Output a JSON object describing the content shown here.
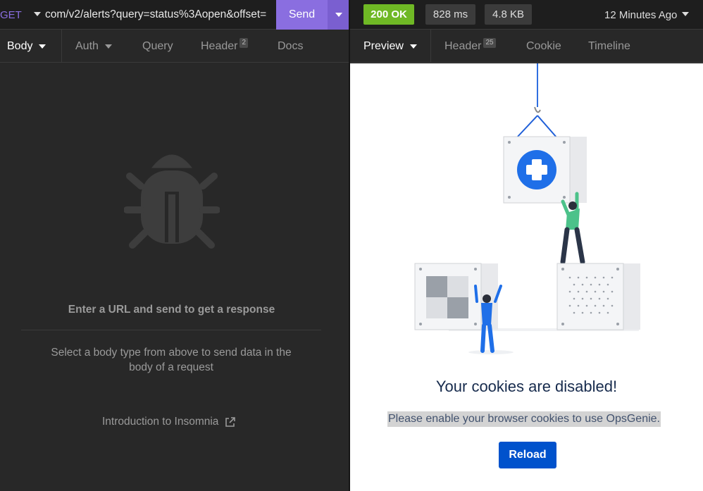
{
  "request": {
    "method": "GET",
    "url": "com/v2/alerts?query=status%3Aopen&offset=",
    "send_label": "Send"
  },
  "response": {
    "status": "200 OK",
    "time": "828 ms",
    "size": "4.8 KB",
    "ago": "12 Minutes Ago"
  },
  "request_tabs": [
    {
      "label": "Body"
    },
    {
      "label": "Auth"
    },
    {
      "label": "Query"
    },
    {
      "label": "Header",
      "badge": "2"
    },
    {
      "label": "Docs"
    }
  ],
  "response_tabs": [
    {
      "label": "Preview"
    },
    {
      "label": "Header",
      "badge": "25"
    },
    {
      "label": "Cookie"
    },
    {
      "label": "Timeline"
    }
  ],
  "body_empty": {
    "title": "Enter a URL and send to get a response",
    "description": "Select a body type from above to send data in the body of a request",
    "link": "Introduction to Insomnia"
  },
  "preview": {
    "title": "Your cookies are disabled!",
    "message": "Please enable your browser cookies to use OpsGenie.",
    "reload_label": "Reload"
  },
  "colors": {
    "accent": "#8a6ee0",
    "status_ok": "#6fb825",
    "reload": "#0052cc"
  }
}
